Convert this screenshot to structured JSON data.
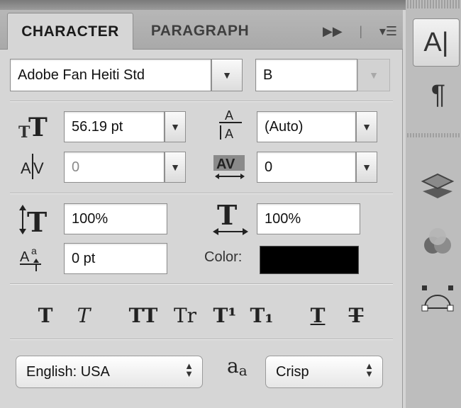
{
  "tabs": {
    "active_label": "CHARACTER",
    "inactive_label": "PARAGRAPH"
  },
  "font": {
    "family": "Adobe Fan Heiti Std",
    "style": "B"
  },
  "size": {
    "value": "56.19 pt"
  },
  "leading": {
    "value": "(Auto)"
  },
  "kerning": {
    "value": "0"
  },
  "tracking": {
    "value": "0"
  },
  "vertical_scale": {
    "value": "100%"
  },
  "horizontal_scale": {
    "value": "100%"
  },
  "baseline_shift": {
    "value": "0 pt"
  },
  "color": {
    "label": "Color:",
    "swatch": "#000000"
  },
  "language": {
    "value": "English: USA"
  },
  "antialias": {
    "value": "Crisp",
    "icon_text": "aa"
  },
  "style_buttons": [
    "T",
    "T",
    "TT",
    "Tr",
    "T¹",
    "T₁",
    "T",
    "T"
  ],
  "icons": {
    "size": "font-size-icon",
    "leading": "leading-icon",
    "kerning": "kerning-icon",
    "tracking": "tracking-icon",
    "vscale": "vertical-scale-icon",
    "hscale": "horizontal-scale-icon",
    "baseline": "baseline-shift-icon"
  }
}
